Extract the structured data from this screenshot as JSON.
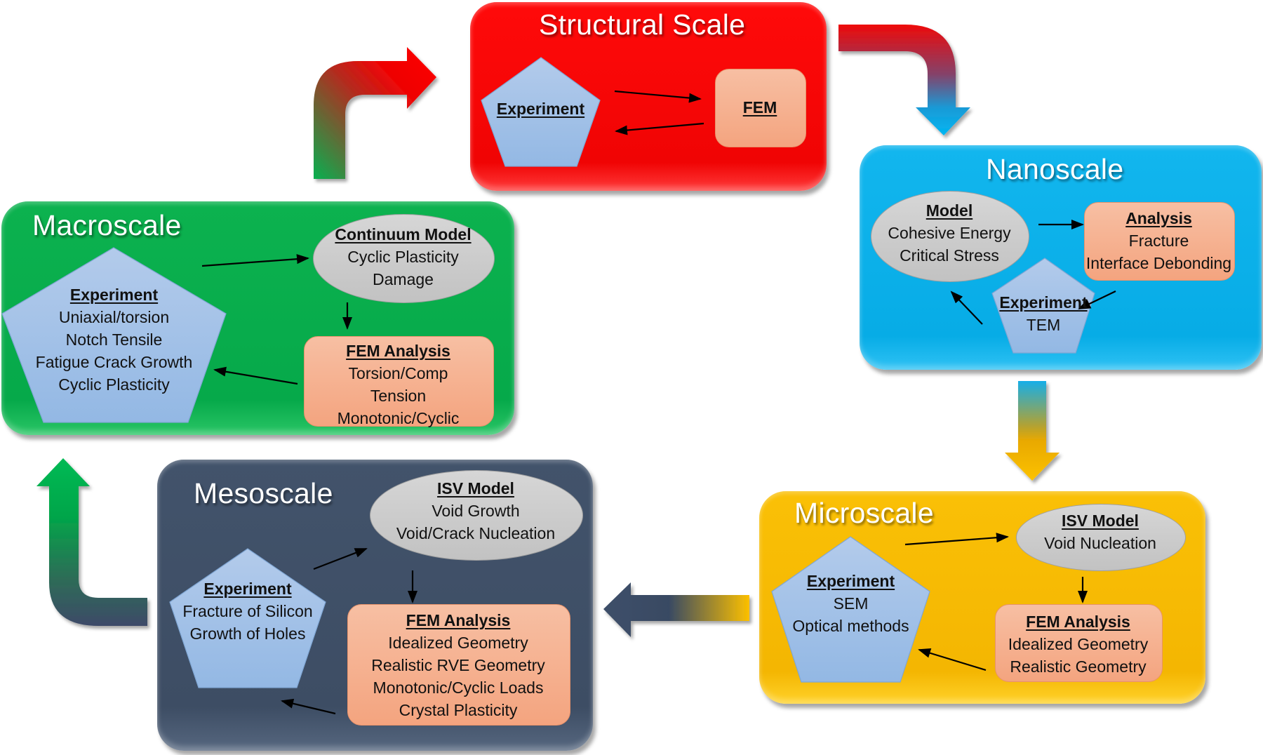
{
  "diagram": {
    "colors": {
      "structural": "#f20505",
      "nano": "#0aaee6",
      "macro": "#08a84a",
      "meso": "#3f4f66",
      "micro": "#f5b602",
      "experiment_fill": "#a5c1e8",
      "model_fill": "#cccccc",
      "fem_fill": "#f6b294"
    },
    "structural": {
      "title": "Structural Scale",
      "experiment": {
        "heading": "Experiment",
        "lines": []
      },
      "fem": {
        "heading": "FEM",
        "lines": []
      }
    },
    "nanoscale": {
      "title": "Nanoscale",
      "model": {
        "heading": "Model",
        "lines": [
          "Cohesive Energy",
          "Critical Stress"
        ]
      },
      "analysis": {
        "heading": "Analysis",
        "lines": [
          "Fracture",
          "Interface Debonding"
        ]
      },
      "experiment": {
        "heading": "Experiment",
        "lines": [
          "TEM"
        ]
      }
    },
    "macroscale": {
      "title": "Macroscale",
      "model": {
        "heading": "Continuum Model",
        "lines": [
          "Cyclic Plasticity",
          "Damage"
        ]
      },
      "experiment": {
        "heading": "Experiment",
        "lines": [
          "Uniaxial/torsion",
          "Notch Tensile",
          "Fatigue Crack Growth",
          "Cyclic Plasticity"
        ]
      },
      "fem": {
        "heading": "FEM Analysis",
        "lines": [
          "Torsion/Comp",
          "Tension",
          "Monotonic/Cyclic"
        ]
      }
    },
    "mesoscale": {
      "title": "Mesoscale",
      "model": {
        "heading": "ISV Model",
        "lines": [
          "Void Growth",
          "Void/Crack Nucleation"
        ]
      },
      "experiment": {
        "heading": "Experiment",
        "lines": [
          "Fracture of Silicon",
          "Growth of Holes"
        ]
      },
      "fem": {
        "heading": "FEM Analysis",
        "lines": [
          "Idealized Geometry",
          "Realistic RVE Geometry",
          "Monotonic/Cyclic Loads",
          "Crystal Plasticity"
        ]
      }
    },
    "microscale": {
      "title": "Microscale",
      "model": {
        "heading": "ISV Model",
        "lines": [
          "Void Nucleation"
        ]
      },
      "experiment": {
        "heading": "Experiment",
        "lines": [
          "SEM",
          "Optical methods"
        ]
      },
      "fem": {
        "heading": "FEM Analysis",
        "lines": [
          "Idealized Geometry",
          "Realistic Geometry"
        ]
      }
    },
    "flow": [
      "Macroscale",
      "Structural Scale",
      "Nanoscale",
      "Microscale",
      "Mesoscale",
      "Macroscale"
    ]
  }
}
